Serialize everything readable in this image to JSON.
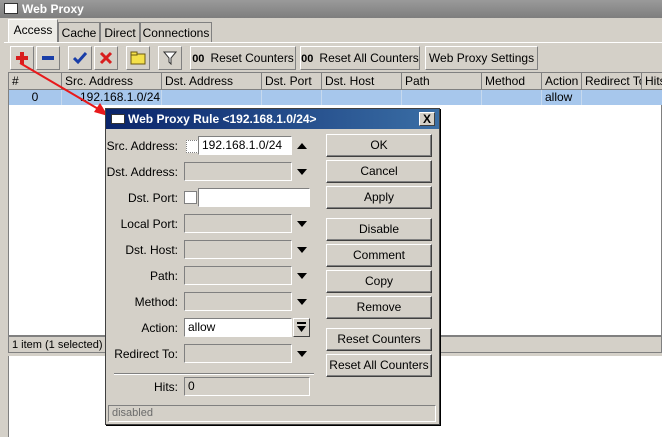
{
  "window": {
    "title": "Web Proxy"
  },
  "tabs": [
    {
      "label": "Access"
    },
    {
      "label": "Cache"
    },
    {
      "label": "Direct"
    },
    {
      "label": "Connections"
    }
  ],
  "toolbar": {
    "reset_counters": "Reset Counters",
    "reset_all_counters": "Reset All Counters",
    "settings": "Web Proxy Settings",
    "oo": "00"
  },
  "table": {
    "columns": [
      "#",
      "Src. Address",
      "Dst. Address",
      "Dst. Port",
      "Dst. Host",
      "Path",
      "Method",
      "Action",
      "Redirect To",
      "Hits"
    ],
    "rows": [
      {
        "num": "0",
        "src": "192.168.1.0/24",
        "action": "allow"
      }
    ]
  },
  "status": "1 item (1 selected)",
  "dialog": {
    "title": "Web Proxy Rule <192.168.1.0/24>",
    "labels": {
      "src": "Src. Address:",
      "dst": "Dst. Address:",
      "dst_port": "Dst. Port:",
      "local_port": "Local Port:",
      "dst_host": "Dst. Host:",
      "path": "Path:",
      "method": "Method:",
      "action": "Action:",
      "redirect": "Redirect To:",
      "hits": "Hits:"
    },
    "values": {
      "src": "192.168.1.0/24",
      "action": "allow",
      "hits": "0"
    },
    "buttons": {
      "ok": "OK",
      "cancel": "Cancel",
      "apply": "Apply",
      "disable": "Disable",
      "comment": "Comment",
      "copy": "Copy",
      "remove": "Remove",
      "reset_counters": "Reset Counters",
      "reset_all_counters": "Reset All Counters"
    },
    "status": "disabled",
    "close": "X"
  },
  "colors": {
    "selection": "#a7c7ec",
    "title_bar": "#0a246a",
    "annotation_arrow": "#e8191b"
  }
}
